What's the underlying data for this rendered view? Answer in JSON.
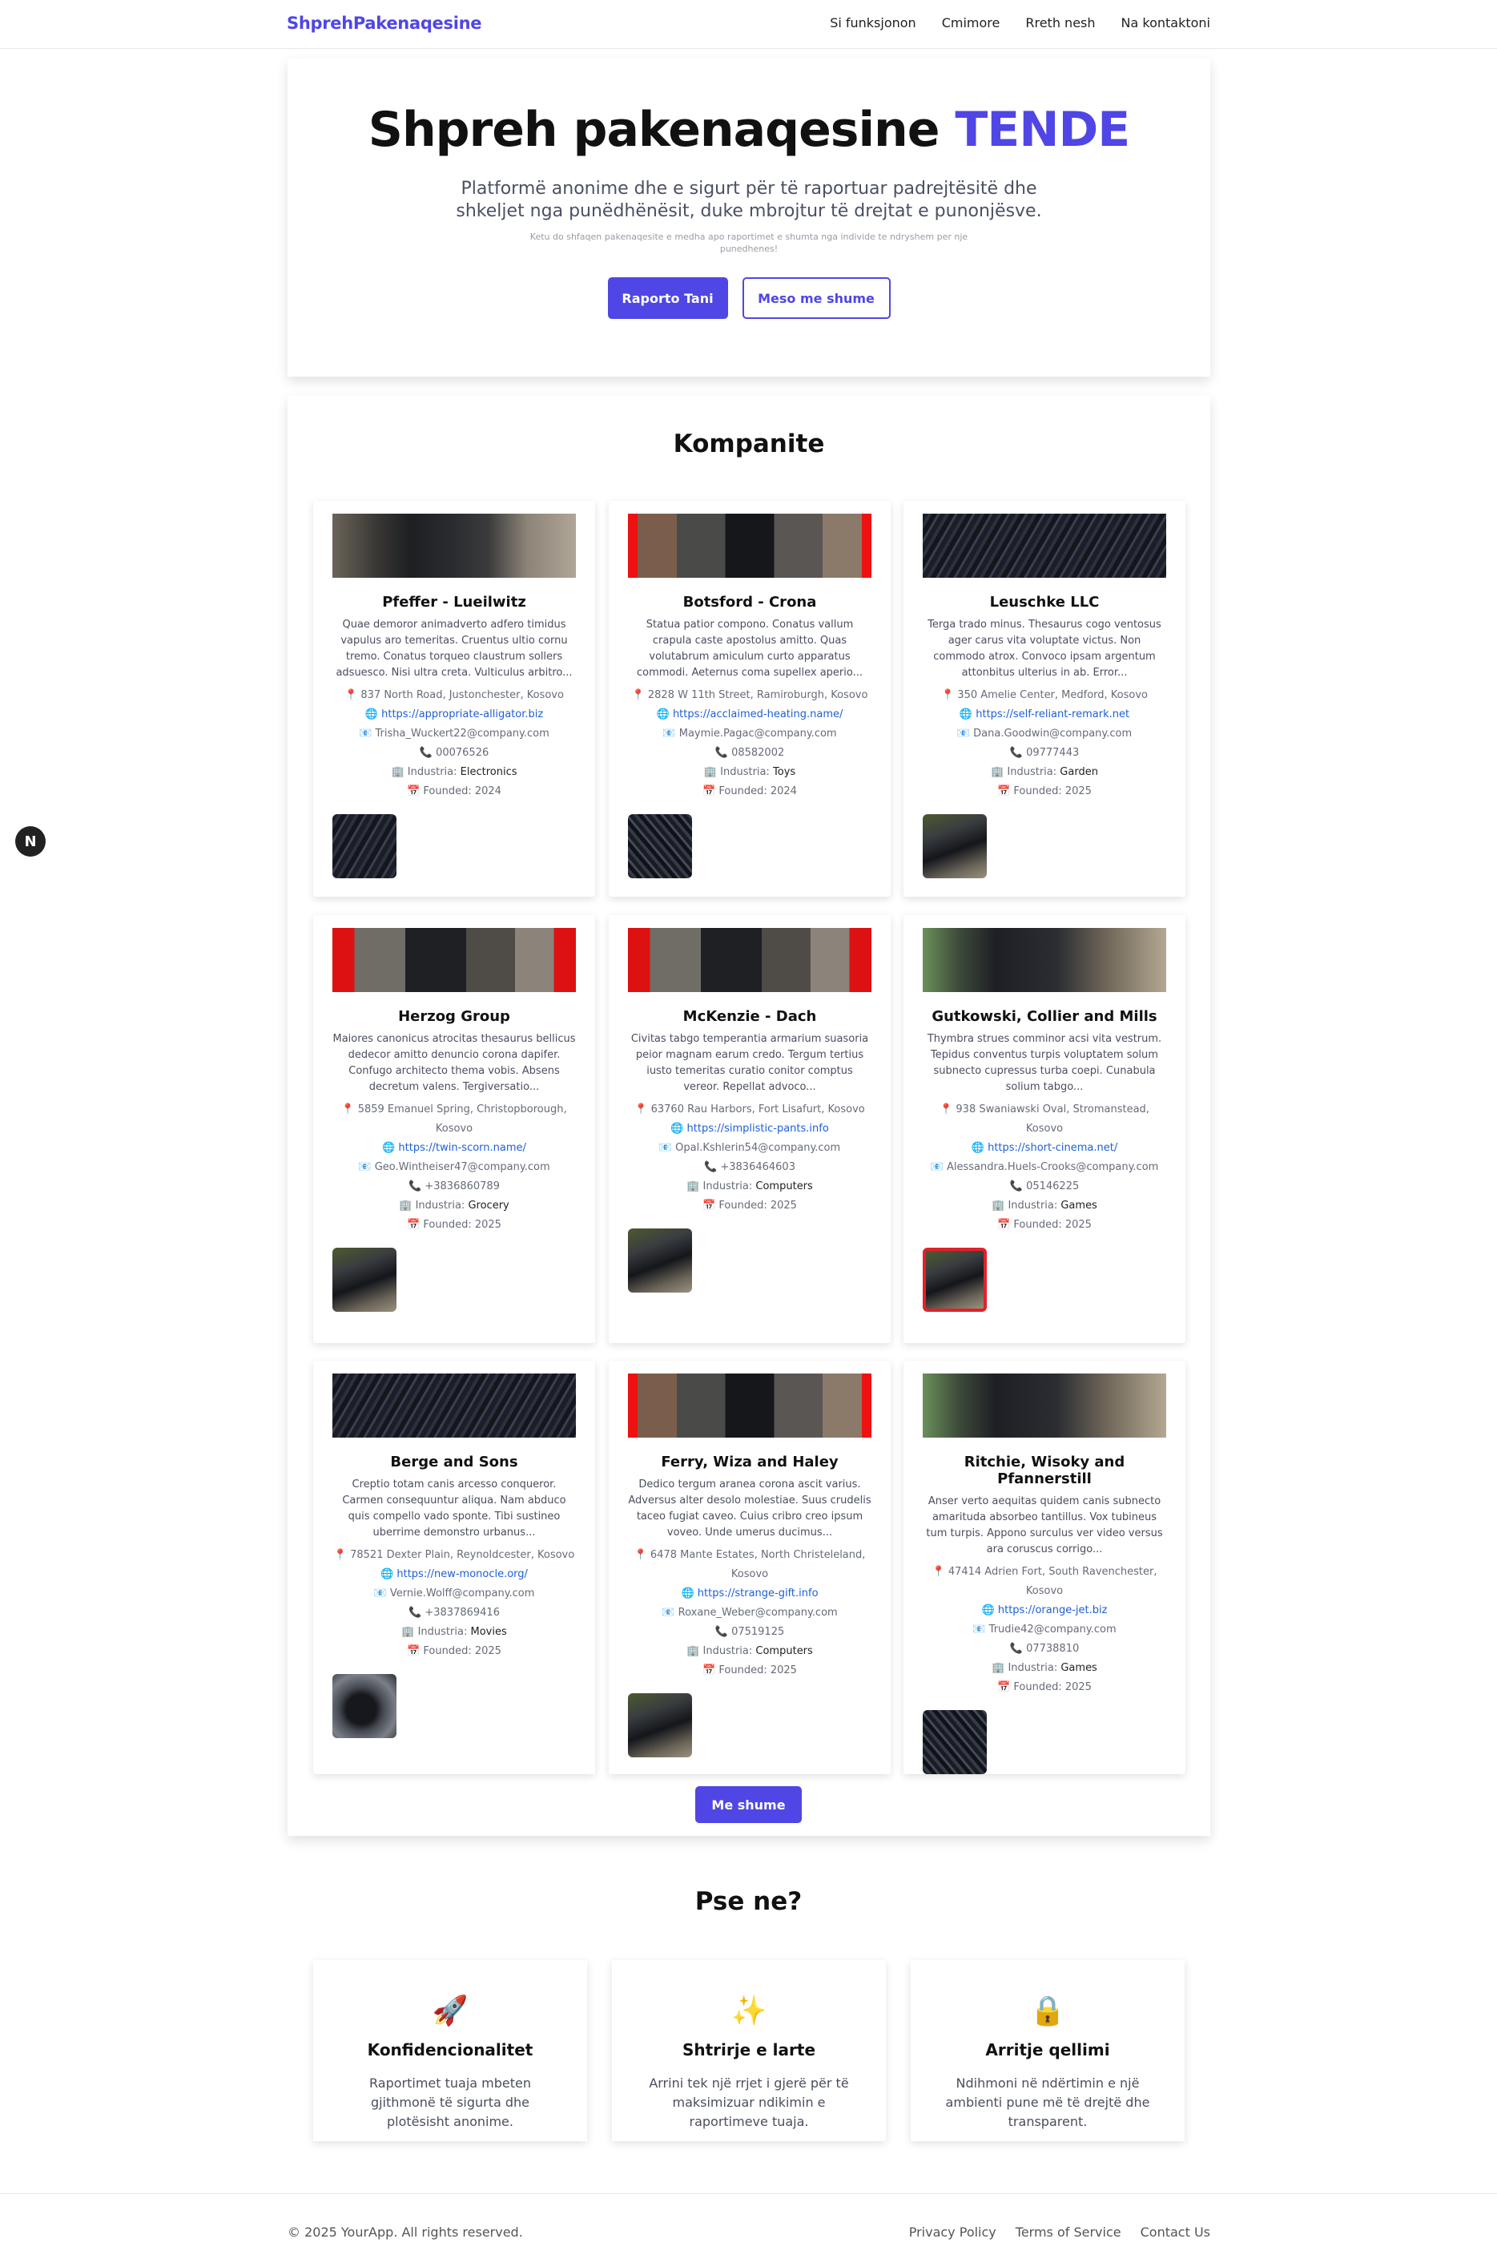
{
  "nav": {
    "brand": "ShprehPakenaqesine",
    "links": [
      "Si funksjonon",
      "Cmimore",
      "Rreth nesh",
      "Na kontaktoni"
    ]
  },
  "hero": {
    "title_main": "Shpreh pakenaqesine",
    "title_accent": "TENDE",
    "subtitle": "Platformë anonime dhe e sigurt për të raportuar padrejtësitë dhe shkeljet nga punëdhënësit, duke mbrojtur të drejtat e punonjësve.",
    "tiny": "Ketu do shfaqen pakenaqesite e medha apo raportimet e shumta nga individe te ndryshem per nje punedhenes!",
    "primary_button": "Raporto Tani",
    "secondary_button": "Meso me shume"
  },
  "companies": {
    "heading": "Kompanite",
    "more_button": "Me shume",
    "labels": {
      "industry": "Industria:",
      "founded": "Founded:"
    },
    "icons": {
      "address": "📍",
      "web": "🌐",
      "email": "📧",
      "phone": "📞",
      "industry": "🏢",
      "founded": "📅"
    },
    "items": [
      {
        "name": "Pfeffer - Lueilwitz",
        "desc": "Quae demoror animadverto adfero timidus vapulus aro temeritas. Cruentus ultio cornu tremo. Conatus torqueo claustrum sollers adsuesco. Nisi ultra creta. Vulticulus arbitro...",
        "address": "837 North Road, Justonchester, Kosovo",
        "url": "https://appropriate-alligator.biz",
        "email": "Trisha_Wuckert22@company.com",
        "phone": "00076526",
        "industry": "Electronics",
        "founded": "2024"
      },
      {
        "name": "Botsford - Crona",
        "desc": "Statua patior compono. Conatus vallum crapula caste apostolus amitto. Quas volutabrum amiculum curto apparatus commodi. Aeternus coma supellex aperio...",
        "address": "2828 W 11th Street, Ramiroburgh, Kosovo",
        "url": "https://acclaimed-heating.name/",
        "email": "Maymie.Pagac@company.com",
        "phone": "08582002",
        "industry": "Toys",
        "founded": "2024"
      },
      {
        "name": "Leuschke LLC",
        "desc": "Terga trado minus. Thesaurus cogo ventosus ager carus vita voluptate victus. Non commodo atrox. Convoco ipsam argentum attonbitus ulterius in ab. Error...",
        "address": "350 Amelie Center, Medford, Kosovo",
        "url": "https://self-reliant-remark.net",
        "email": "Dana.Goodwin@company.com",
        "phone": "09777443",
        "industry": "Garden",
        "founded": "2025"
      },
      {
        "name": "Herzog Group",
        "desc": "Maiores canonicus atrocitas thesaurus bellicus dedecor amitto denuncio corona dapifer. Confugo architecto thema vobis. Absens decretum valens. Tergiversatio...",
        "address": "5859 Emanuel Spring, Christopborough, Kosovo",
        "url": "https://twin-scorn.name/",
        "email": "Geo.Wintheiser47@company.com",
        "phone": "+3836860789",
        "industry": "Grocery",
        "founded": "2025"
      },
      {
        "name": "McKenzie - Dach",
        "desc": "Civitas tabgo temperantia armarium suasoria peior magnam earum credo. Tergum tertius iusto temeritas curatio conitor comptus vereor. Repellat advoco...",
        "address": "63760 Rau Harbors, Fort Lisafurt, Kosovo",
        "url": "https://simplistic-pants.info",
        "email": "Opal.Kshlerin54@company.com",
        "phone": "+3836464603",
        "industry": "Computers",
        "founded": "2025"
      },
      {
        "name": "Gutkowski, Collier and Mills",
        "desc": "Thymbra strues comminor acsi vita vestrum. Tepidus conventus turpis voluptatem solum subnecto cupressus turba coepi. Cunabula solium tabgo...",
        "address": "938 Swaniawski Oval, Stromanstead, Kosovo",
        "url": "https://short-cinema.net/",
        "email": "Alessandra.Huels-Crooks@company.com",
        "phone": "05146225",
        "industry": "Games",
        "founded": "2025"
      },
      {
        "name": "Berge and Sons",
        "desc": "Creptio totam canis arcesso conqueror. Carmen consequuntur aliqua. Nam abduco quis compello vado sponte. Tibi sustineo uberrime demonstro urbanus...",
        "address": "78521 Dexter Plain, Reynoldcester, Kosovo",
        "url": "https://new-monocle.org/",
        "email": "Vernie.Wolff@company.com",
        "phone": "+3837869416",
        "industry": "Movies",
        "founded": "2025"
      },
      {
        "name": "Ferry, Wiza and Haley",
        "desc": "Dedico tergum aranea corona ascit varius. Adversus alter desolo molestiae. Suus crudelis taceo fugiat caveo. Cuius cribro creo ipsum voveo. Unde umerus ducimus...",
        "address": "6478 Mante Estates, North Christeleland, Kosovo",
        "url": "https://strange-gift.info",
        "email": "Roxane_Weber@company.com",
        "phone": "07519125",
        "industry": "Computers",
        "founded": "2025"
      },
      {
        "name": "Ritchie, Wisoky and Pfannerstill",
        "desc": "Anser verto aequitas quidem canis subnecto amarituda absorbeo tantillus. Vox tubineus tum turpis. Appono surculus ver video versus ara coruscus corrigo...",
        "address": "47414 Adrien Fort, South Ravenchester, Kosovo",
        "url": "https://orange-jet.biz",
        "email": "Trudie42@company.com",
        "phone": "07738810",
        "industry": "Games",
        "founded": "2025"
      }
    ]
  },
  "why": {
    "heading": "Pse ne?",
    "features": [
      {
        "icon": "🚀",
        "icon_name": "rocket-icon",
        "title": "Konfidencionalitet",
        "desc": "Raportimet tuaja mbeten gjithmonë të sigurta dhe plotësisht anonime."
      },
      {
        "icon": "✨",
        "icon_name": "sparkles-icon",
        "title": "Shtrirje e larte",
        "desc": "Arrini tek një rrjet i gjerë për të maksimizuar ndikimin e raportimeve tuaja."
      },
      {
        "icon": "🔒",
        "icon_name": "lock-icon",
        "title": "Arritje qellimi",
        "desc": "Ndihmoni në ndërtimin e një ambienti pune më të drejtë dhe transparent."
      }
    ]
  },
  "footer": {
    "copyright": "© 2025 YourApp. All rights reserved.",
    "links": [
      "Privacy Policy",
      "Terms of Service",
      "Contact Us"
    ]
  },
  "badge": "N",
  "colors": {
    "accent": "#4f46e5",
    "link": "#1d5fd6",
    "highlight": "#e2202a"
  }
}
